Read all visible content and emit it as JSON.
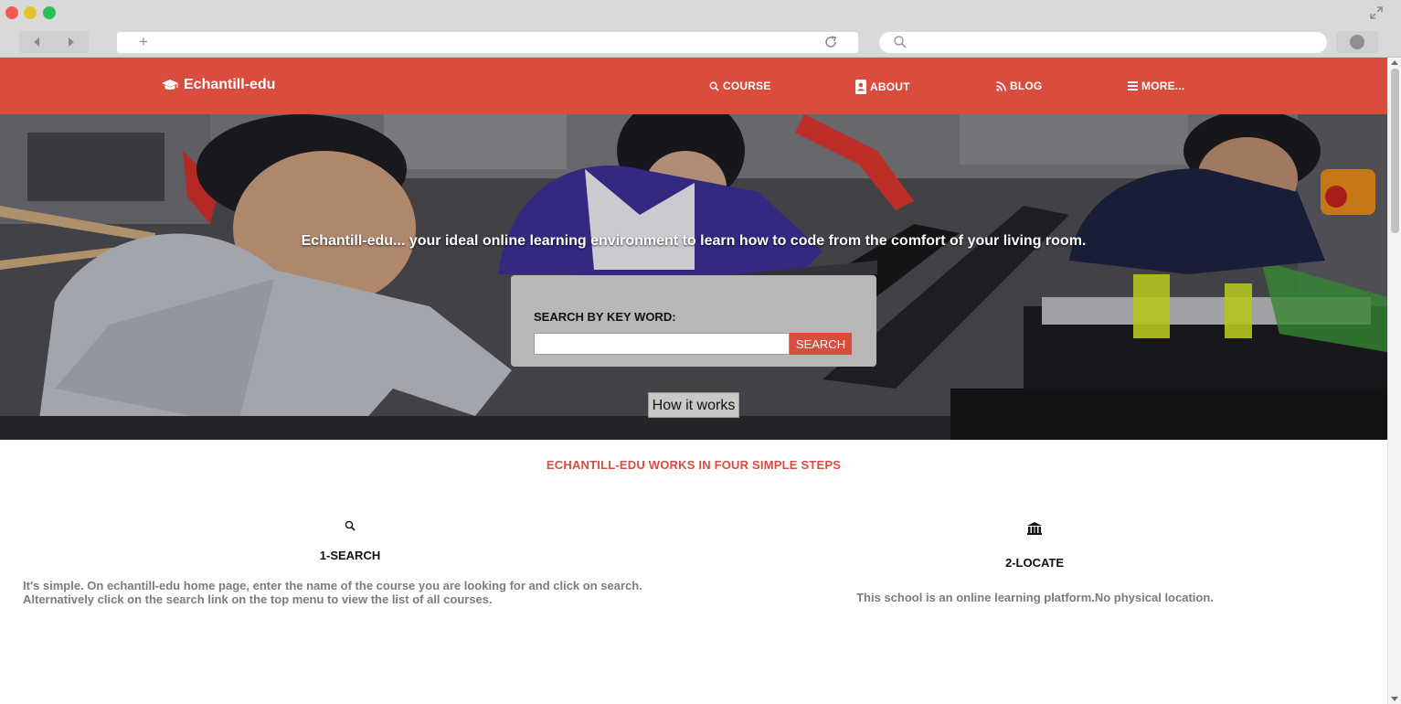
{
  "browser": {
    "url": "",
    "search_placeholder": ""
  },
  "nav": {
    "brand": "Echantill-edu",
    "links": [
      {
        "label": "COURSE",
        "icon": "search-icon"
      },
      {
        "label": "ABOUT",
        "icon": "contact-card-icon"
      },
      {
        "label": "BLOG",
        "icon": "rss-icon"
      },
      {
        "label": "MORE...",
        "icon": "menu-icon"
      }
    ]
  },
  "hero": {
    "tagline": "Echantill-edu... your ideal online learning environment to learn how to code from the comfort of your living room.",
    "search_label": "SEARCH BY KEY WORD:",
    "search_value": "",
    "search_button": "SEARCH",
    "how_button": "How it works"
  },
  "steps": {
    "heading": "ECHANTILL-EDU WORKS IN FOUR SIMPLE STEPS",
    "items": [
      {
        "title": "1-SEARCH",
        "icon": "search-icon",
        "desc_line1": "It's simple. On echantill-edu home page, enter the name of the course you are looking for and click on search.",
        "desc_line2": "Alternatively click on the search link on the top menu to view the list of all courses."
      },
      {
        "title": "2-LOCATE",
        "icon": "institution-icon",
        "desc_line1": "This school is an online learning platform.No physical location."
      }
    ]
  },
  "colors": {
    "brand": "#d94c3e",
    "nav_text": "#ffffff",
    "step_text": "#7c7c7c"
  }
}
